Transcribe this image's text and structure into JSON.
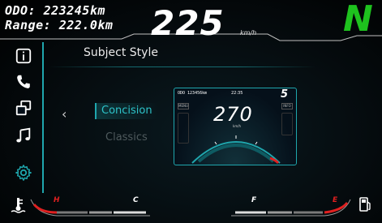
{
  "header": {
    "odo": "ODO: 223245km",
    "range": "Range: 222.0km",
    "speed": "225",
    "speed_unit": "km/h",
    "gear": "N"
  },
  "sidebar": {
    "items": [
      {
        "icon": "info-icon"
      },
      {
        "icon": "phone-icon"
      },
      {
        "icon": "screen-mirror-icon"
      },
      {
        "icon": "music-note-icon"
      },
      {
        "icon": "settings-gear-icon",
        "active": true
      }
    ]
  },
  "page": {
    "title": "Subject Style",
    "back_chevron": "‹",
    "options": [
      {
        "label": "Concision",
        "selected": true
      },
      {
        "label": "Classics",
        "selected": false
      }
    ]
  },
  "preview": {
    "odo": "ODO 123456km",
    "time": "22:35",
    "gear": "5",
    "speed": "270",
    "speed_unit": "km/h",
    "menu": "MENU",
    "info": "INFO"
  },
  "gauges": {
    "temp_high": "H",
    "temp_low": "C",
    "fuel_full": "F",
    "fuel_empty": "E"
  },
  "colors": {
    "accent": "#1fa6ad",
    "gear_green": "#1ec21e",
    "warning_red": "#e02020"
  }
}
